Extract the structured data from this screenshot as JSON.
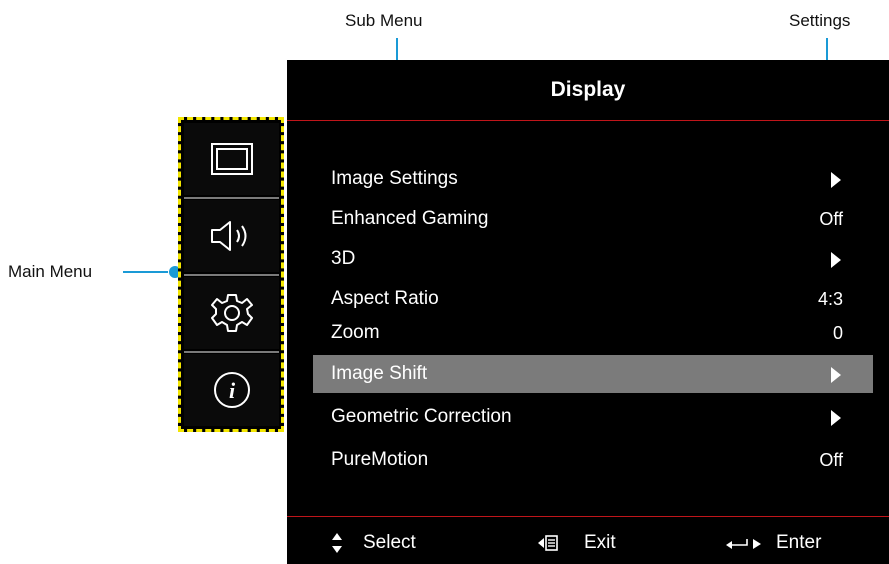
{
  "callouts": {
    "sub_menu": "Sub Menu",
    "settings": "Settings",
    "main_menu": "Main Menu"
  },
  "main_menu": {
    "items": [
      {
        "icon": "display-icon"
      },
      {
        "icon": "speaker-icon"
      },
      {
        "icon": "gear-icon"
      },
      {
        "icon": "info-icon"
      }
    ]
  },
  "osd": {
    "title": "Display",
    "rows": [
      {
        "label": "Image Settings",
        "value": "",
        "has_arrow": true
      },
      {
        "label": "Enhanced Gaming",
        "value": "Off",
        "has_arrow": false
      },
      {
        "label": "3D",
        "value": "",
        "has_arrow": true
      },
      {
        "label": "Aspect Ratio",
        "value": "4:3",
        "has_arrow": false
      },
      {
        "label": "Zoom",
        "value": "0",
        "has_arrow": false
      },
      {
        "label": "Image Shift",
        "value": "",
        "has_arrow": true,
        "selected": true
      },
      {
        "label": "Geometric Correction",
        "value": "",
        "has_arrow": true
      },
      {
        "label": "PureMotion",
        "value": "Off",
        "has_arrow": false
      }
    ],
    "footer": {
      "select": "Select",
      "exit": "Exit",
      "enter": "Enter"
    }
  },
  "colors": {
    "callout": "#1a9ad6",
    "main_menu_border": "#f3e600",
    "divider": "#c0151a",
    "selected_row": "#7b7b7b"
  }
}
